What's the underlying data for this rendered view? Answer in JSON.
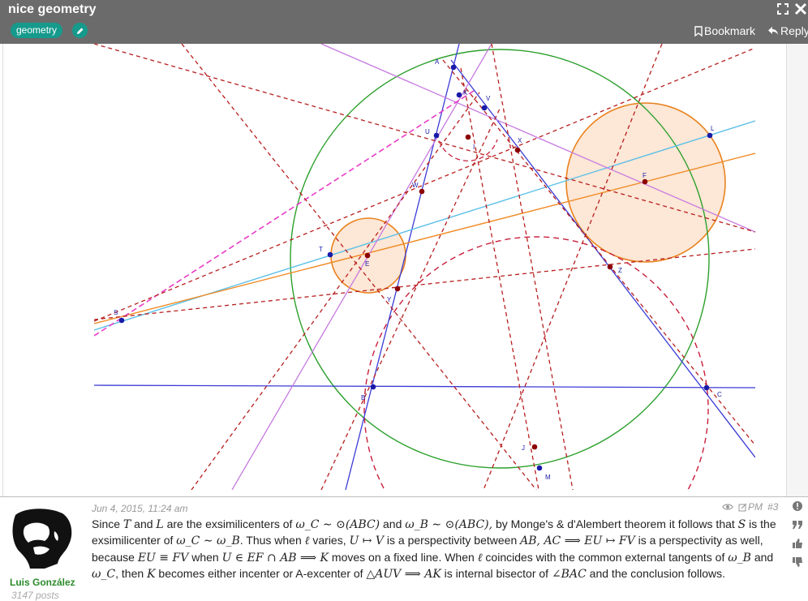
{
  "header": {
    "title": "nice geometry",
    "tag": "geometry",
    "bookmark_label": "Bookmark",
    "reply_label": "Reply"
  },
  "figure": {
    "labels": {
      "A": "A",
      "B": "B",
      "C": "C",
      "K": "K",
      "V": "V",
      "U": "U",
      "I": "I",
      "X": "X",
      "L": "L",
      "F": "F",
      "W": "W",
      "T": "T",
      "E": "E",
      "Y": "Y",
      "Z": "Z",
      "S": "S",
      "J": "J",
      "M": "M"
    },
    "colors": {
      "circumcircle": "#2ca02c",
      "incircle_like": "#e8821e",
      "circle_fill": "#fde7d6",
      "blue_line": "#3b3bd6",
      "cyan_line": "#5bc0e8",
      "orange_line": "#f08a24",
      "violet_line": "#c77ae0",
      "magenta_line": "#e83cc7",
      "red_dashed": "#b81e1e"
    }
  },
  "post": {
    "date": "Jun 4, 2015, 11:24 am",
    "pm_label": "PM",
    "post_number": "#3",
    "author": "Luis González",
    "posts_count": "3147 posts",
    "text": [
      {
        "t": "Since "
      },
      {
        "m": "T"
      },
      {
        "t": " and "
      },
      {
        "m": "L"
      },
      {
        "t": " are the exsimilicenters of "
      },
      {
        "m": "ω_C ∼ ⊙(ABC)"
      },
      {
        "t": " and "
      },
      {
        "m": "ω_B ∼ ⊙(ABC),"
      },
      {
        "t": " by Monge's & d'Alembert theorem it follows that "
      },
      {
        "m": "S"
      },
      {
        "t": " is the exsimilicenter of "
      },
      {
        "m": "ω_C ∼ ω_B"
      },
      {
        "t": ". Thus when "
      },
      {
        "m": "ℓ"
      },
      {
        "t": " varies, "
      },
      {
        "m": "U ↦ V"
      },
      {
        "t": " is a perspectivity between "
      },
      {
        "m": "AB, AC ⟹ EU ↦ FV"
      },
      {
        "t": " is a perspectivity as well, because "
      },
      {
        "m": "EU ≡ FV"
      },
      {
        "t": " when "
      },
      {
        "m": "U ∈ EF ∩ AB ⟹ K"
      },
      {
        "t": " moves on a fixed line. When "
      },
      {
        "m": "ℓ"
      },
      {
        "t": " coincides with the common external tangents of "
      },
      {
        "m": "ω_B"
      },
      {
        "t": " and "
      },
      {
        "m": "ω_C"
      },
      {
        "t": ", then "
      },
      {
        "m": "K"
      },
      {
        "t": " becomes either incenter or A-excenter of "
      },
      {
        "m": "△AUV ⟹ AK"
      },
      {
        "t": " is internal bisector of "
      },
      {
        "m": "∠BAC"
      },
      {
        "t": " and the conclusion follows."
      }
    ]
  }
}
